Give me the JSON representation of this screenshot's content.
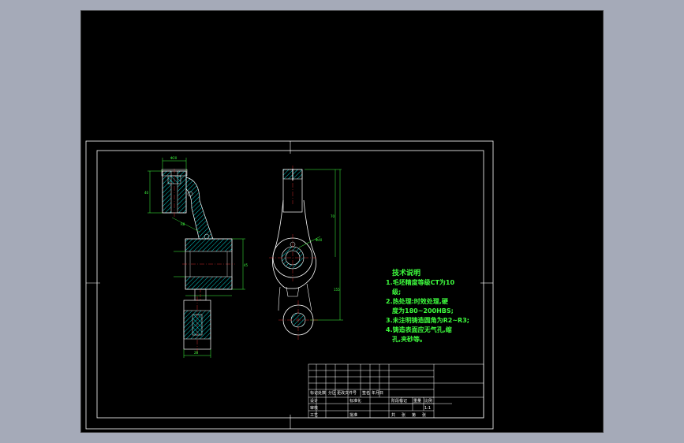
{
  "colors": {
    "background": "#a5aab8",
    "canvas": "#000000",
    "frame": "#ffffff",
    "part_outline": "#ffffff",
    "hatch": "#00ffff",
    "dimension": "#3fff3f",
    "centerline": "#ff3030",
    "tech_text": "#3fff3f"
  },
  "tech_notes": {
    "title": "技术说明",
    "lines": [
      "1.毛坯精度等级CT为10",
      "级;",
      "2.热处理:时效处理,硬",
      "度为180~200HBS;",
      "3.未注明铸造圆角为R2~R3;",
      "4.铸造表面应无气孔,缩",
      "孔,夹砂等。"
    ]
  },
  "title_block": {
    "row_labels": [
      "标记",
      "设计",
      "审核",
      "工艺"
    ],
    "col_labels": [
      "处数",
      "分区",
      "更改文件号",
      "签名",
      "年月日"
    ],
    "standardization": "标准化",
    "approve": "批准",
    "stage_labels": [
      "阶段标记",
      "重量",
      "比例"
    ],
    "sheet_labels": [
      "共",
      "张",
      "第",
      "张"
    ],
    "scale": "1:1"
  },
  "dimensions": {
    "top_boss_width": "Φ20",
    "left_height": "40",
    "right_total_height": "155",
    "right_upper": "70",
    "mid_bore": "Φ40",
    "angle_label": "R8",
    "bottom_width": "28",
    "bottom_height": "20",
    "hub_height": "45"
  }
}
